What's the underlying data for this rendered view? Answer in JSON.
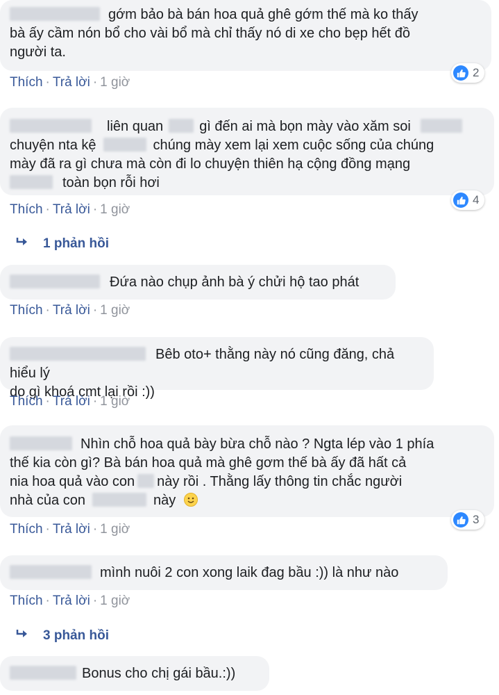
{
  "colors": {
    "bubble": "#f2f3f5",
    "link": "#385898",
    "meta": "#90949c",
    "like_badge": "#2d88ff"
  },
  "actions": {
    "like": "Thích",
    "reply": "Trả lời",
    "separator": "·",
    "time": "1 giờ"
  },
  "comments": [
    {
      "lines": [
        "gớm bảo bà bán hoa quả ghê gớm thế mà ko thấy",
        "bà ấy cầm nón bổ cho vài bổ mà chỉ thấy nó di xe cho bẹp hết đồ",
        "người ta."
      ],
      "reactions": "2"
    },
    {
      "lines": [
        "liên quan",
        "gì đến ai mà bọn mày vào xăm soi",
        "chuyện nta kệ",
        "chúng mày xem lại xem cuộc sống của chúng",
        "mày đã ra gì chưa mà còn đi lo chuyện thiên hạ cộng đồng mạng",
        "toàn bọn rỗi hơi"
      ],
      "reactions": "4",
      "replies": "1 phản hồi"
    },
    {
      "lines": [
        "Đứa nào chụp ảnh bà ý chửi hộ tao phát"
      ]
    },
    {
      "lines": [
        "Bêb oto+ thằng này nó cũng đăng, chả hiểu lý",
        "do gì khoá cmt lại rồi :))"
      ]
    },
    {
      "lines": [
        "Nhìn chỗ hoa quả bày bừa chỗ nào ? Ngta lép vào 1 phía",
        "thế kia còn gì? Bà bán hoa quả mà ghê gơm thế bà ấy đã hất cả",
        "nia hoa quả vào con",
        "này rồi . Thằng lấy thông tin chắc người",
        "nhà của con",
        "này"
      ],
      "reactions": "3"
    },
    {
      "lines": [
        "mình nuôi 2 con xong laik đag bầu :)) là như nào"
      ],
      "replies": "3 phản hồi"
    },
    {
      "lines": [
        "Bonus cho chị gái bầu.:))"
      ]
    }
  ],
  "icons": {
    "like": "thumbs-up-icon",
    "reply_arrow": "reply-arrow-icon",
    "smile": "smiling-emoji-icon"
  }
}
